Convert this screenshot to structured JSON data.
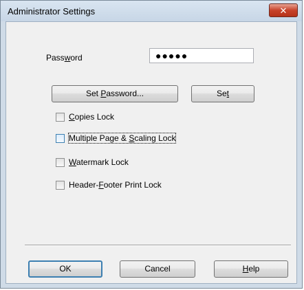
{
  "window": {
    "title": "Administrator Settings",
    "close_glyph": "✕"
  },
  "password": {
    "label": "Password",
    "value": "●●●●●"
  },
  "buttons": {
    "set_password": "Set Password...",
    "set": "Set",
    "ok": "OK",
    "cancel": "Cancel",
    "help": "Help"
  },
  "checkboxes": [
    {
      "label": "Copies Lock",
      "checked": false
    },
    {
      "label": "Multiple Page & Scaling Lock",
      "checked": false,
      "focused": true
    },
    {
      "label": "Watermark Lock",
      "checked": false
    },
    {
      "label": "Header-Footer Print Lock",
      "checked": false
    }
  ],
  "colors": {
    "accent": "#3c7fb1",
    "close": "#c7432a"
  }
}
